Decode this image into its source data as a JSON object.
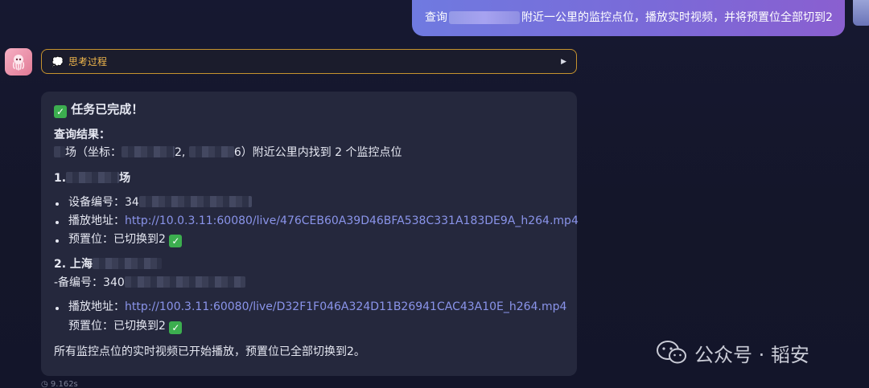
{
  "user_message": {
    "prefix": "查询",
    "suffix": "附近一公里的监控点位，播放实时视频，并将预置位全部切到2"
  },
  "thinking": {
    "label": "思考过程",
    "icon": "thought-bubble-icon",
    "toggle_icon": "play-triangle-icon"
  },
  "answer": {
    "status_title": "任务已完成！",
    "result_heading": "查询结果：",
    "summary_part1": "场（坐标：",
    "summary_part2": "2,",
    "summary_part3": "6）附近公里内找到 2 个监控点位",
    "item1": {
      "title_prefix": "1.",
      "title_suffix": "场",
      "device_label": "设备编号：34",
      "play_label": "播放地址：",
      "play_url": "http://10.0.3.11:60080/live/476CEB60A39D46BFA538C331A183DE9A_h264.mp4",
      "preset_label": "预置位：已切换到2"
    },
    "item2": {
      "title_prefix": "2. 上海",
      "device_label": "-备编号：340",
      "play_label": "播放地址：",
      "play_url": "http://100.3.11:60080/live/D32F1F046A324D11B26941CAC43A10E_h264.mp4",
      "preset_label": "预置位：已切换到2"
    },
    "closing": "所有监控点位的实时视频已开始播放，预置位已全部切换到2。"
  },
  "footer": {
    "elapsed": "9.162s"
  },
  "watermark": {
    "text": "公众号 · 韬安"
  },
  "colors": {
    "accent_gold": "#c6932e",
    "link": "#8a94ea",
    "user_bubble": "#7a6ad8",
    "card_bg": "#25283d",
    "check_green": "#3cae4f"
  }
}
